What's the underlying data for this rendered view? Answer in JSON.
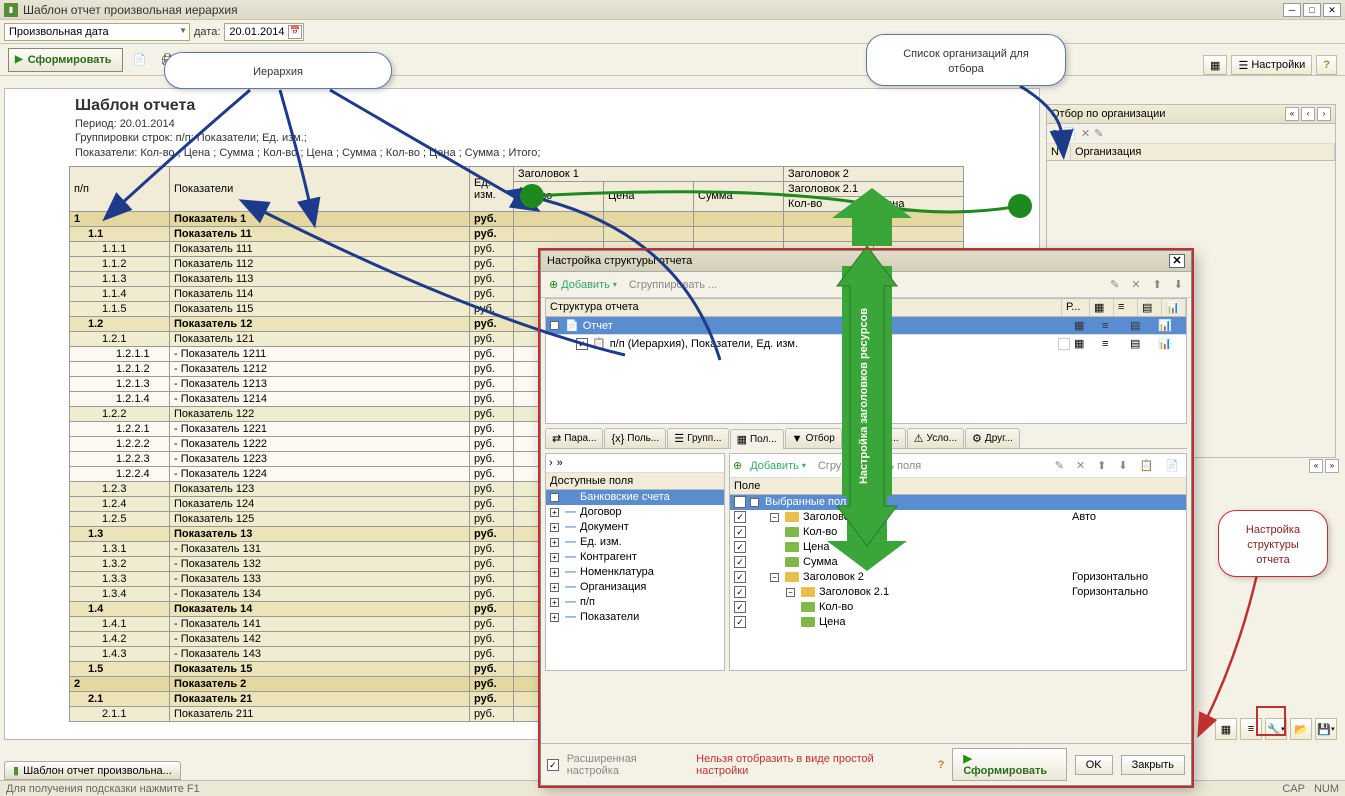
{
  "window": {
    "title": "Шаблон отчет произвольная иерархия"
  },
  "top": {
    "combo": "Произвольная дата",
    "date_label": "дата:",
    "date_value": "20.01.2014",
    "form_btn": "Сформировать",
    "settings_btn": "Настройки"
  },
  "bubbles": {
    "hierarchy": "Иерархия",
    "orgs": "Список организаций для отбора",
    "struct": "Настройка структуры отчета",
    "arrow_text": "Настройка заголовков ресурсов"
  },
  "report": {
    "title": "Шаблон отчета",
    "line1": "Период: 20.01.2014",
    "line2": "Группировки строк: п/п; Показатели; Ед. изм.;",
    "line3_label": "Показатели:",
    "measures": [
      "Кол-во",
      "Цена",
      "Сумма",
      "Кол-во",
      "Цена",
      "Сумма",
      "Кол-во",
      "Цена",
      "Сумма",
      "Итого"
    ],
    "th": {
      "pp": "п/п",
      "pok": "Показатели",
      "ed": "Ед. изм.",
      "h1": "Заголовок 1",
      "h2": "Заголовок 2",
      "h21": "Заголовок 2.1",
      "kol": "Кол-во",
      "cena": "Цена",
      "sum": "Сумма"
    },
    "rows": [
      {
        "lvl": 1,
        "n": "1",
        "t": "Показатель 1",
        "u": "руб."
      },
      {
        "lvl": 2,
        "n": "1.1",
        "t": "Показатель 11",
        "u": "руб."
      },
      {
        "lvl": 3,
        "n": "1.1.1",
        "t": "Показатель 111",
        "u": "руб."
      },
      {
        "lvl": 3,
        "n": "1.1.2",
        "t": "Показатель 112",
        "u": "руб."
      },
      {
        "lvl": 3,
        "n": "1.1.3",
        "t": "Показатель 113",
        "u": "руб."
      },
      {
        "lvl": 3,
        "n": "1.1.4",
        "t": "Показатель 114",
        "u": "руб."
      },
      {
        "lvl": 3,
        "n": "1.1.5",
        "t": "Показатель 115",
        "u": "руб."
      },
      {
        "lvl": 2,
        "n": "1.2",
        "t": "Показатель 12",
        "u": "руб."
      },
      {
        "lvl": 3,
        "n": "1.2.1",
        "t": "Показатель 121",
        "u": "руб."
      },
      {
        "lvl": 4,
        "n": "1.2.1.1",
        "t": "- Показатель 1211",
        "u": "руб."
      },
      {
        "lvl": 4,
        "n": "1.2.1.2",
        "t": "- Показатель 1212",
        "u": "руб."
      },
      {
        "lvl": 4,
        "n": "1.2.1.3",
        "t": "- Показатель 1213",
        "u": "руб."
      },
      {
        "lvl": 4,
        "n": "1.2.1.4",
        "t": "- Показатель 1214",
        "u": "руб."
      },
      {
        "lvl": 3,
        "n": "1.2.2",
        "t": "Показатель 122",
        "u": "руб."
      },
      {
        "lvl": 4,
        "n": "1.2.2.1",
        "t": "- Показатель 1221",
        "u": "руб."
      },
      {
        "lvl": 4,
        "n": "1.2.2.2",
        "t": "- Показатель 1222",
        "u": "руб."
      },
      {
        "lvl": 4,
        "n": "1.2.2.3",
        "t": "- Показатель 1223",
        "u": "руб."
      },
      {
        "lvl": 4,
        "n": "1.2.2.4",
        "t": "- Показатель 1224",
        "u": "руб."
      },
      {
        "lvl": 3,
        "n": "1.2.3",
        "t": "Показатель 123",
        "u": "руб."
      },
      {
        "lvl": 3,
        "n": "1.2.4",
        "t": "Показатель 124",
        "u": "руб."
      },
      {
        "lvl": 3,
        "n": "1.2.5",
        "t": "Показатель 125",
        "u": "руб."
      },
      {
        "lvl": 2,
        "n": "1.3",
        "t": "Показатель 13",
        "u": "руб."
      },
      {
        "lvl": 3,
        "n": "1.3.1",
        "t": "- Показатель 131",
        "u": "руб."
      },
      {
        "lvl": 3,
        "n": "1.3.2",
        "t": "- Показатель 132",
        "u": "руб."
      },
      {
        "lvl": 3,
        "n": "1.3.3",
        "t": "- Показатель 133",
        "u": "руб."
      },
      {
        "lvl": 3,
        "n": "1.3.4",
        "t": "- Показатель 134",
        "u": "руб."
      },
      {
        "lvl": 2,
        "n": "1.4",
        "t": "Показатель 14",
        "u": "руб."
      },
      {
        "lvl": 3,
        "n": "1.4.1",
        "t": "- Показатель 141",
        "u": "руб."
      },
      {
        "lvl": 3,
        "n": "1.4.2",
        "t": "- Показатель 142",
        "u": "руб."
      },
      {
        "lvl": 3,
        "n": "1.4.3",
        "t": "- Показатель 143",
        "u": "руб."
      },
      {
        "lvl": 2,
        "n": "1.5",
        "t": "Показатель 15",
        "u": "руб."
      },
      {
        "lvl": 1,
        "n": "2",
        "t": "Показатель 2",
        "u": "руб."
      },
      {
        "lvl": 2,
        "n": "2.1",
        "t": "Показатель 21",
        "u": "руб."
      },
      {
        "lvl": 3,
        "n": "2.1.1",
        "t": "Показатель 211",
        "u": "руб."
      }
    ]
  },
  "rightpanel": {
    "title": "Отбор по организации",
    "col_n": "N",
    "col_org": "Организация"
  },
  "modal": {
    "title": "Настройка структуры отчета",
    "add": "Добавить",
    "group": "Сгруппировать ...",
    "struct_hdr": "Структура отчета",
    "report_node": "Отчет",
    "fields_node": "п/п (Иерархия), Показатели, Ед. изм.",
    "col_p": "Р...",
    "tabs": [
      "Пара...",
      "Поль...",
      "Групп...",
      "Пол...",
      "Отбор",
      "Сорти...",
      "Усло...",
      "Друг..."
    ],
    "avail_hdr": "Доступные поля",
    "field_hdr": "Поле",
    "avail": [
      "Банковские счета",
      "Договор",
      "Документ",
      "Ед. изм.",
      "Контрагент",
      "Номенклатура",
      "Организация",
      "п/п",
      "Показатели"
    ],
    "sel_root": "Выбранные поля",
    "sel": [
      {
        "t": "Заголовок 1",
        "m": "Авто",
        "folder": true
      },
      {
        "t": "Кол-во",
        "m": ""
      },
      {
        "t": "Цена",
        "m": ""
      },
      {
        "t": "Сумма",
        "m": ""
      },
      {
        "t": "Заголовок 2",
        "m": "Горизонтально",
        "folder": true
      },
      {
        "t": "Заголовок 2.1",
        "m": "Горизонтально",
        "folder": true,
        "indent": 1
      },
      {
        "t": "Кол-во",
        "m": "",
        "indent": 1
      },
      {
        "t": "Цена",
        "m": "",
        "indent": 1
      }
    ],
    "add_field": "Добавить",
    "grp_field": "Сгруппировать поля",
    "ext": "Расширенная настройка",
    "warn": "Нельзя отобразить в виде простой настройки",
    "form": "Сформировать",
    "ok": "OK",
    "close": "Закрыть"
  },
  "status": {
    "hint": "Для получения подсказки нажмите F1",
    "cap": "CAP",
    "num": "NUM"
  },
  "tab": "Шаблон отчет произвольна..."
}
